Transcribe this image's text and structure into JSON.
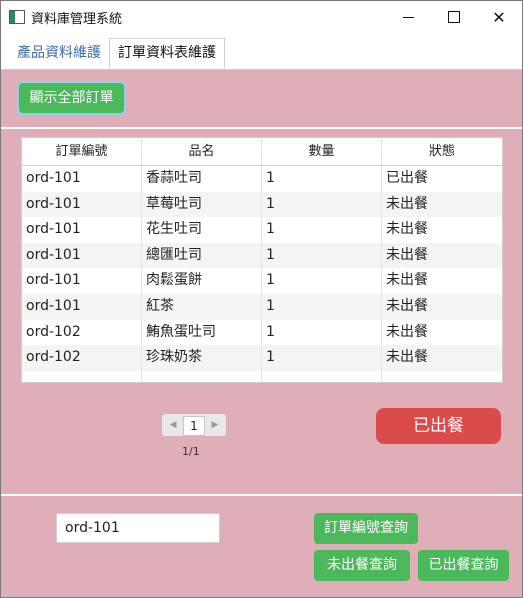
{
  "window": {
    "title": "資料庫管理系統"
  },
  "tabs": [
    {
      "label": "產品資料維護"
    },
    {
      "label": "訂單資料表維護"
    }
  ],
  "toolbar": {
    "show_all_label": "顯示全部訂單"
  },
  "table": {
    "columns": [
      "訂單編號",
      "品名",
      "數量",
      "狀態"
    ],
    "rows": [
      [
        "ord-101",
        "香蒜吐司",
        "1",
        "已出餐"
      ],
      [
        "ord-101",
        "草莓吐司",
        "1",
        "未出餐"
      ],
      [
        "ord-101",
        "花生吐司",
        "1",
        "未出餐"
      ],
      [
        "ord-101",
        "總匯吐司",
        "1",
        "未出餐"
      ],
      [
        "ord-101",
        "肉鬆蛋餅",
        "1",
        "未出餐"
      ],
      [
        "ord-101",
        "紅茶",
        "1",
        "未出餐"
      ],
      [
        "ord-102",
        "鮪魚蛋吐司",
        "1",
        "未出餐"
      ],
      [
        "ord-102",
        "珍珠奶茶",
        "1",
        "未出餐"
      ]
    ]
  },
  "pagination": {
    "current": "1",
    "count_text": "1/1",
    "prev_icon": "chevron-left-icon",
    "next_icon": "chevron-right-icon"
  },
  "actions": {
    "served_label": "已出餐"
  },
  "search": {
    "value": "ord-101",
    "query_by_id_label": "訂單編號查詢",
    "query_unserved_label": "未出餐查詢",
    "query_served_label": "已出餐查詢"
  },
  "colors": {
    "background": "#e0aeb9",
    "green_button": "#4cb85c",
    "red_button": "#dc4b4b",
    "tab_active_text": "#3a6ea5"
  }
}
